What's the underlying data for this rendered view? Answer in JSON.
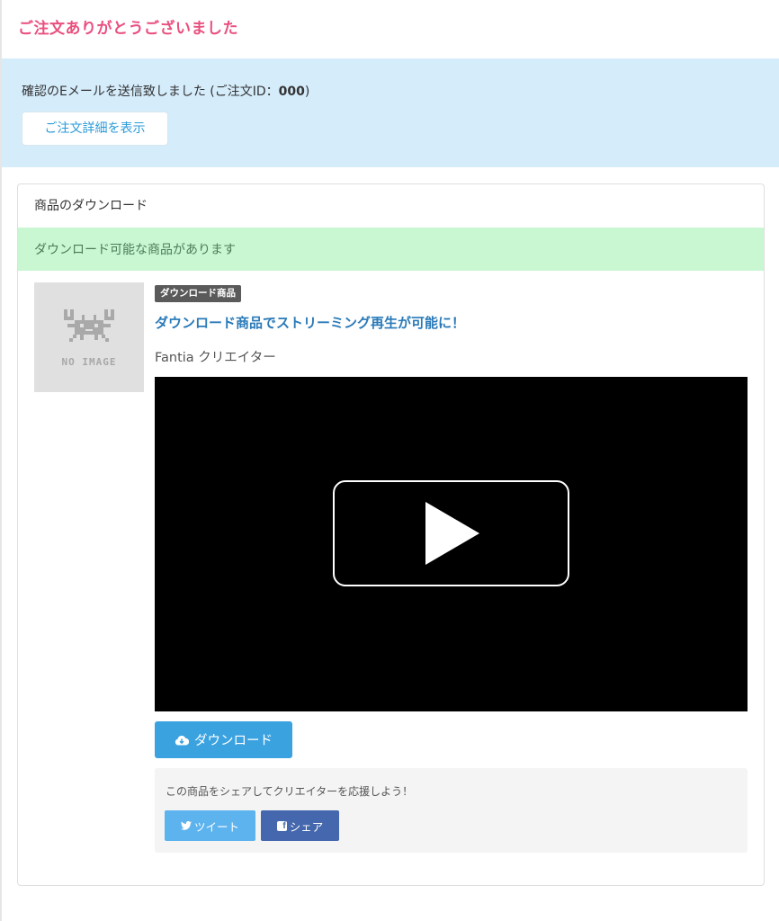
{
  "page": {
    "title": "ご注文ありがとうございました"
  },
  "confirm": {
    "text_prefix": "確認のEメールを送信致しました (ご注文ID：",
    "order_id": "000",
    "text_suffix": ")",
    "detail_button_label": "ご注文詳細を表示"
  },
  "download_section": {
    "header": "商品のダウンロード",
    "alert": "ダウンロード可能な商品があります",
    "thumbnail_text": "NO IMAGE",
    "badge": "ダウンロード商品",
    "product_title": "ダウンロード商品でストリーミング再生が可能に！",
    "creator": "Fantia クリエイター",
    "download_button_label": "ダウンロード"
  },
  "share": {
    "text": "この商品をシェアしてクリエイターを応援しよう！",
    "tweet_label": "ツイート",
    "facebook_label": "シェア"
  },
  "colors": {
    "title_pink": "#e9507f",
    "confirm_bg": "#d5ecfb",
    "alert_green_bg": "#c8f7d2",
    "link_blue": "#2a7ab8",
    "download_blue": "#3ba2e0",
    "twitter_blue": "#5cb3ee",
    "facebook_blue": "#4467ad"
  }
}
